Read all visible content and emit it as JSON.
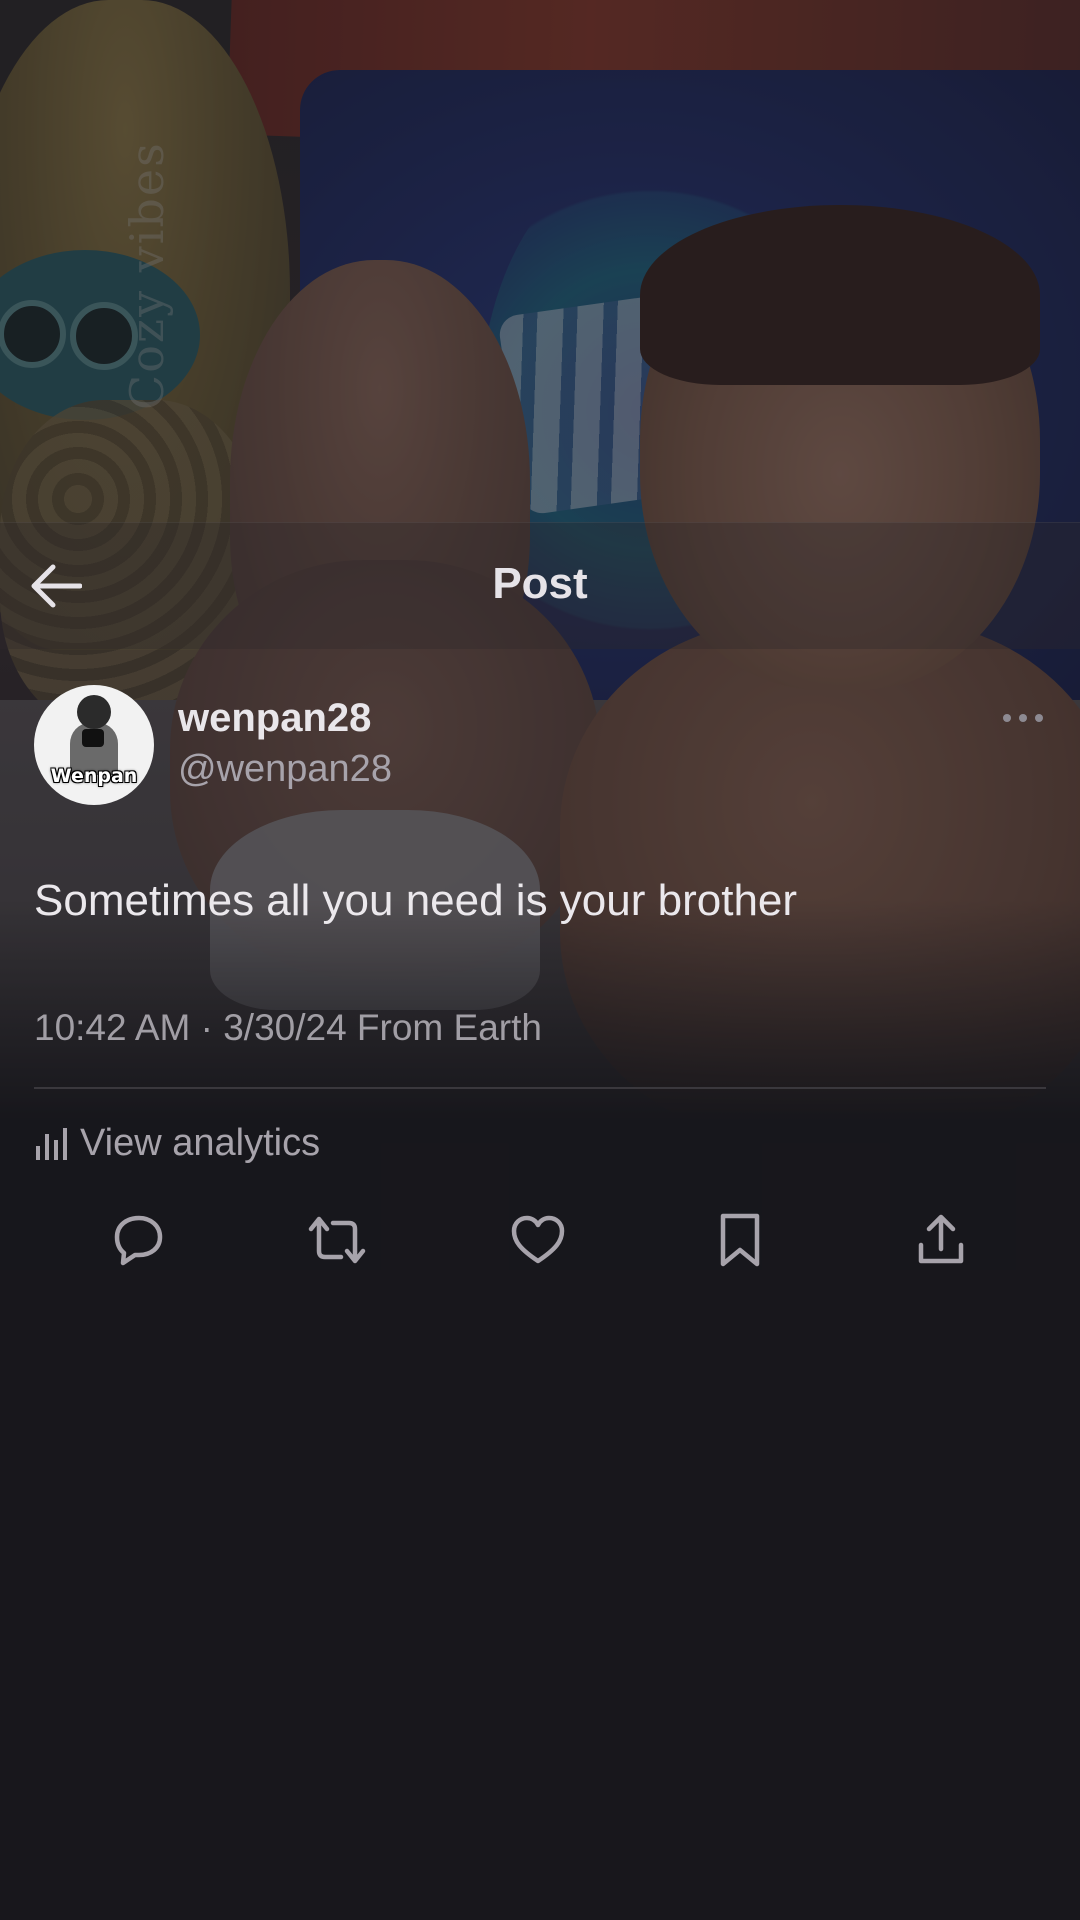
{
  "background": {
    "watermark_text": "Cozy vibes"
  },
  "header": {
    "title": "Post",
    "back_icon": "arrow-left-icon"
  },
  "author": {
    "display_name": "wenpan28",
    "handle": "@wenpan28",
    "avatar_text": "Wenpan"
  },
  "post": {
    "text": "Sometimes all you need is your brother",
    "meta": "10:42 AM · 3/30/24 From Earth"
  },
  "analytics": {
    "label": "View analytics",
    "icon": "bar-chart-icon"
  },
  "actions": [
    {
      "name": "reply",
      "icon": "reply-icon"
    },
    {
      "name": "repost",
      "icon": "repost-icon"
    },
    {
      "name": "like",
      "icon": "heart-icon"
    },
    {
      "name": "bookmark",
      "icon": "bookmark-icon"
    },
    {
      "name": "share",
      "icon": "share-icon"
    }
  ],
  "colors": {
    "background": "#1b1a1f",
    "text": "#e7e7ea",
    "muted": "#a7a3ab"
  }
}
